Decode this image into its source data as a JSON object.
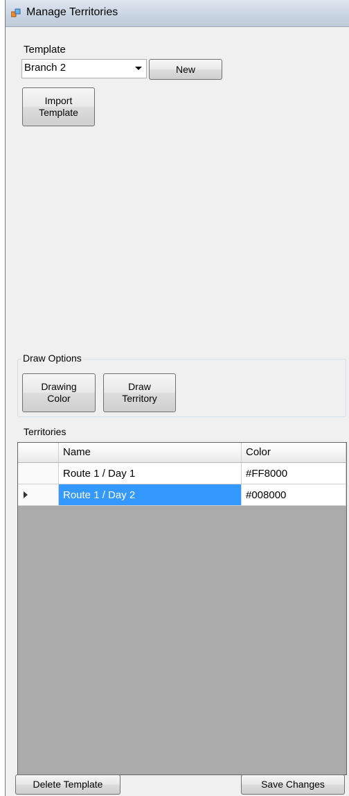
{
  "window": {
    "title": "Manage Territories"
  },
  "template": {
    "label": "Template",
    "selected": "Branch 2",
    "new_label": "New",
    "import_label_line1": "Import",
    "import_label_line2": "Template"
  },
  "draw_options": {
    "title": "Draw Options",
    "color_line1": "Drawing",
    "color_line2": "Color",
    "territory_line1": "Draw",
    "territory_line2": "Territory"
  },
  "territories": {
    "title": "Territories",
    "columns": [
      "Name",
      "Color"
    ],
    "rows": [
      {
        "name": "Route 1 / Day 1",
        "color": "#FF8000",
        "selected": false
      },
      {
        "name": "Route 1 / Day 2",
        "color": "#008000",
        "selected": true
      }
    ]
  },
  "footer": {
    "delete_label": "Delete Template",
    "save_label": "Save Changes"
  }
}
